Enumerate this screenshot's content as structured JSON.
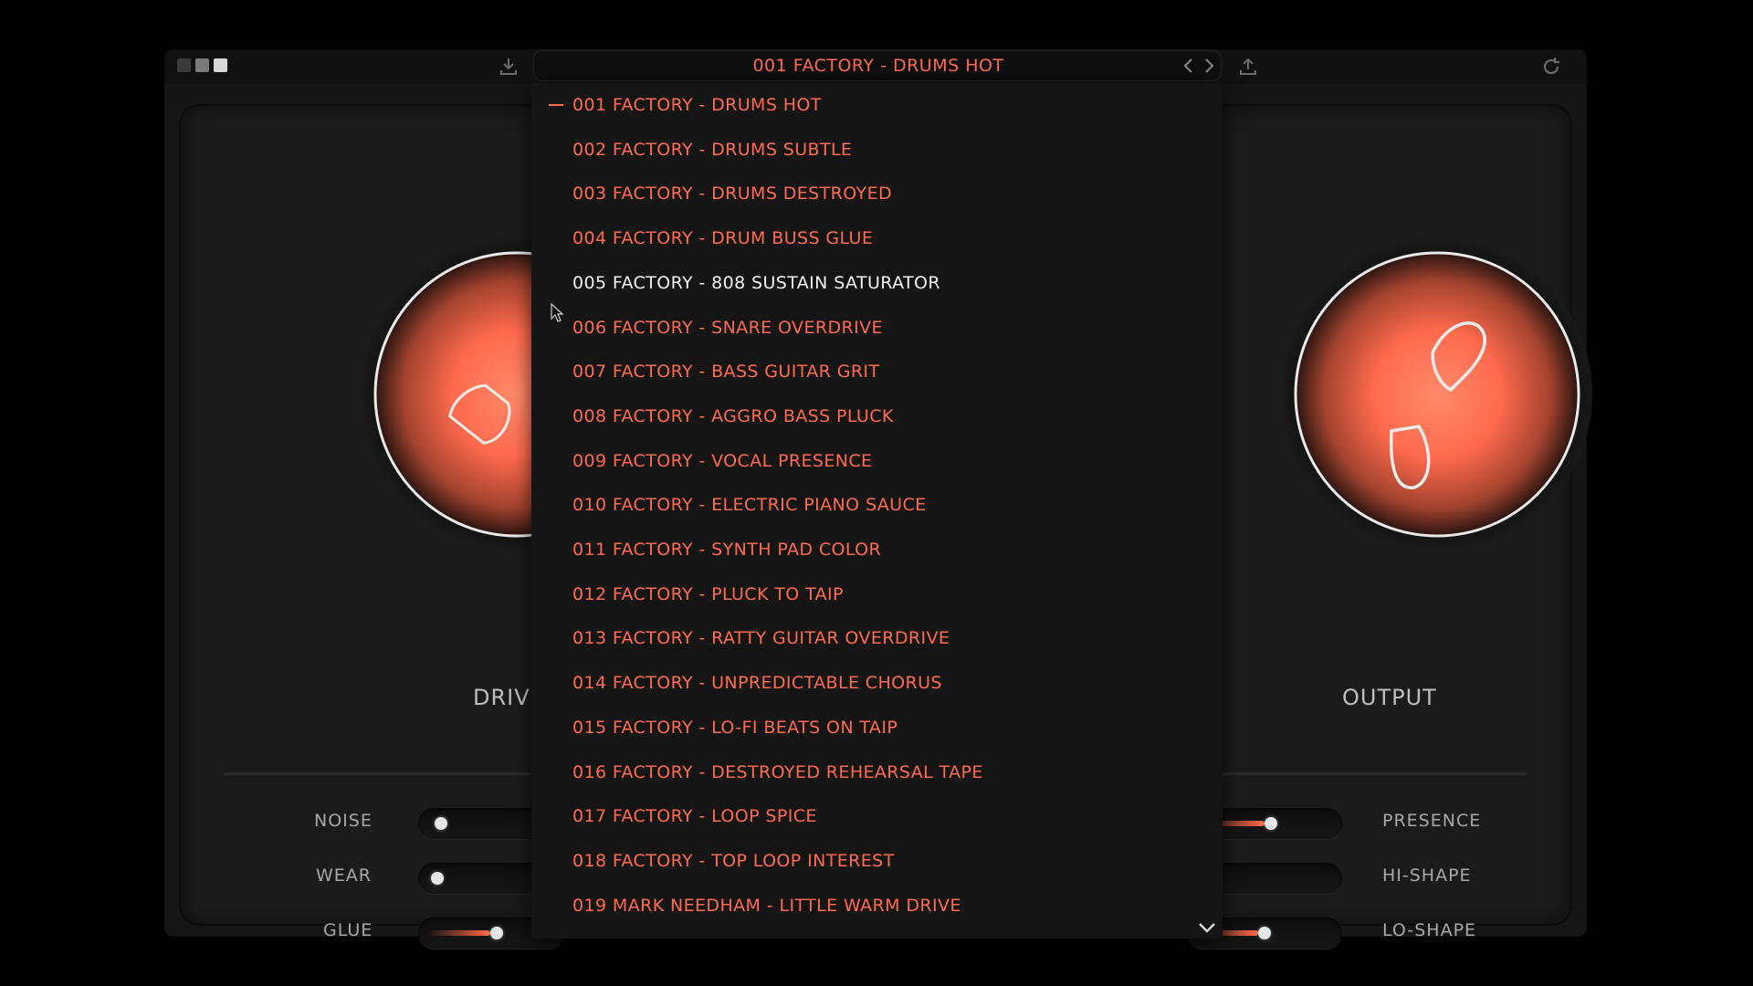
{
  "colors": {
    "accent": "#ff6a4d",
    "hover_text": "#f2f2f2",
    "label": "#a8a8a8",
    "background": "#161616"
  },
  "topbar": {
    "window_squares": [
      "#3a3a3a",
      "#7a7a7a",
      "#d8d8d8"
    ],
    "save_icon": "download-icon",
    "export_icon": "upload-icon",
    "reset_icon": "refresh-icon"
  },
  "preset_browser": {
    "current": "001 FACTORY - DRUMS HOT",
    "prev_icon": "chevron-left-icon",
    "next_icon": "chevron-right-icon",
    "selected_index": 0,
    "hovered_index": 4,
    "items": [
      "001 FACTORY - DRUMS HOT",
      "002 FACTORY - DRUMS SUBTLE",
      "003 FACTORY - DRUMS DESTROYED",
      "004 FACTORY - DRUM BUSS GLUE",
      "005 FACTORY - 808 SUSTAIN SATURATOR",
      "006 FACTORY - SNARE OVERDRIVE",
      "007 FACTORY - BASS GUITAR GRIT",
      "008 FACTORY - AGGRO BASS PLUCK",
      "009 FACTORY - VOCAL PRESENCE",
      "010 FACTORY - ELECTRIC PIANO SAUCE",
      "011 FACTORY - SYNTH PAD COLOR",
      "012 FACTORY - PLUCK TO TAIP",
      "013 FACTORY - RATTY GUITAR OVERDRIVE",
      "014 FACTORY - UNPREDICTABLE CHORUS",
      "015 FACTORY - LO-FI BEATS ON TAIP",
      "016 FACTORY - DESTROYED REHEARSAL TAPE",
      "017 FACTORY - LOOP SPICE",
      "018 FACTORY - TOP LOOP INTEREST",
      "019 MARK NEEDHAM - LITTLE WARM DRIVE"
    ],
    "scroll_icon": "chevron-down-icon"
  },
  "knobs": {
    "drive": {
      "label": "DRIVE"
    },
    "output": {
      "label": "OUTPUT"
    }
  },
  "sliders": {
    "left": [
      {
        "label": "NOISE",
        "value": 0.05
      },
      {
        "label": "WEAR",
        "value": 0.02
      },
      {
        "label": "GLUE",
        "value": 0.55
      }
    ],
    "right": [
      {
        "label": "PRESENCE",
        "value": 0.55
      },
      {
        "label": "HI-SHAPE",
        "value": 0.05
      },
      {
        "label": "LO-SHAPE",
        "value": 0.5
      }
    ]
  }
}
